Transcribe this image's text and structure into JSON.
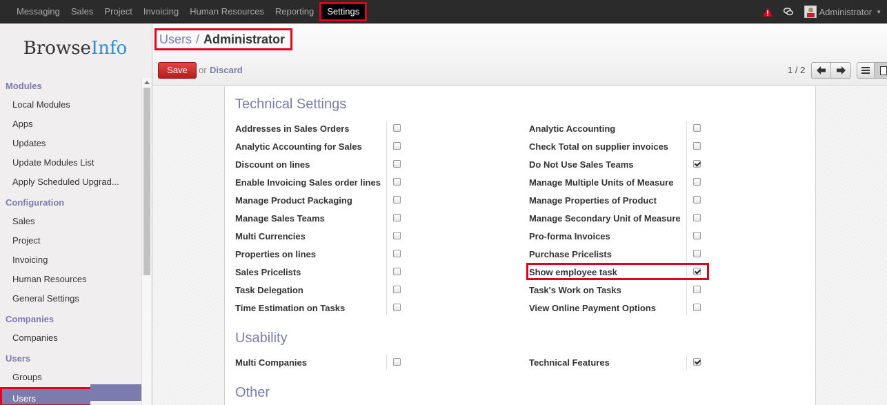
{
  "topbar": {
    "menu": [
      "Messaging",
      "Sales",
      "Project",
      "Invoicing",
      "Human Resources",
      "Reporting",
      "Settings"
    ],
    "active": "Settings",
    "user": "Administrator",
    "colors": {
      "bar": "#2b2b2b",
      "highlight": "#e00020"
    }
  },
  "sidebar": {
    "logo": {
      "part1": "Browse",
      "part2": "Info"
    },
    "sections": [
      {
        "title": "Modules",
        "items": [
          "Local Modules",
          "Apps",
          "Updates",
          "Update Modules List",
          "Apply Scheduled Upgrad..."
        ]
      },
      {
        "title": "Configuration",
        "items": [
          "Sales",
          "Project",
          "Invoicing",
          "Human Resources",
          "General Settings"
        ]
      },
      {
        "title": "Companies",
        "items": [
          "Companies"
        ]
      },
      {
        "title": "Users",
        "items": [
          "Groups",
          "Users"
        ]
      }
    ],
    "selected": "Users"
  },
  "header": {
    "breadcrumb": {
      "parent": "Users",
      "separator": "/",
      "current": "Administrator"
    },
    "save_label": "Save",
    "or_label": "or",
    "discard_label": "Discard",
    "pager": "1 / 2"
  },
  "form": {
    "technical": {
      "title": "Technical Settings",
      "left": [
        {
          "label": "Addresses in Sales Orders",
          "checked": false
        },
        {
          "label": "Analytic Accounting for Sales",
          "checked": false
        },
        {
          "label": "Discount on lines",
          "checked": false
        },
        {
          "label": "Enable Invoicing Sales order lines",
          "checked": false
        },
        {
          "label": "Manage Product Packaging",
          "checked": false
        },
        {
          "label": "Manage Sales Teams",
          "checked": false
        },
        {
          "label": "Multi Currencies",
          "checked": false
        },
        {
          "label": "Properties on lines",
          "checked": false
        },
        {
          "label": "Sales Pricelists",
          "checked": false
        },
        {
          "label": "Task Delegation",
          "checked": false
        },
        {
          "label": "Time Estimation on Tasks",
          "checked": false
        }
      ],
      "right": [
        {
          "label": "Analytic Accounting",
          "checked": false
        },
        {
          "label": "Check Total on supplier invoices",
          "checked": false
        },
        {
          "label": "Do Not Use Sales Teams",
          "checked": true
        },
        {
          "label": "Manage Multiple Units of Measure",
          "checked": false
        },
        {
          "label": "Manage Properties of Product",
          "checked": false
        },
        {
          "label": "Manage Secondary Unit of Measure",
          "checked": false
        },
        {
          "label": "Pro-forma Invoices",
          "checked": false
        },
        {
          "label": "Purchase Pricelists",
          "checked": false
        },
        {
          "label": "Show employee task",
          "checked": true
        },
        {
          "label": "Task's Work on Tasks",
          "checked": false
        },
        {
          "label": "View Online Payment Options",
          "checked": false
        }
      ]
    },
    "usability": {
      "title": "Usability",
      "left": [
        {
          "label": "Multi Companies",
          "checked": false
        }
      ],
      "right": [
        {
          "label": "Technical Features",
          "checked": true
        }
      ]
    },
    "other": {
      "title": "Other"
    }
  }
}
